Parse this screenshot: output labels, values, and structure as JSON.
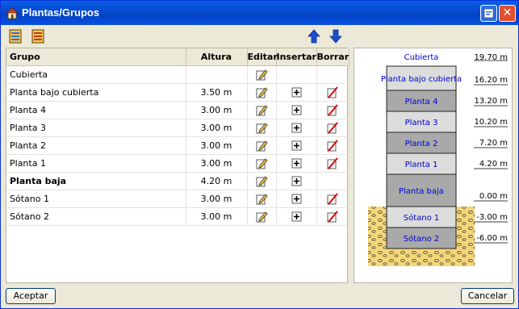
{
  "window": {
    "title": "Plantas/Grupos"
  },
  "icons": {
    "title": "building-icon",
    "help": "help-icon",
    "close": "close-icon",
    "toolbar": [
      "add-floor-icon",
      "edit-floor-icon"
    ],
    "up": "arrow-up-icon",
    "down": "arrow-down-icon",
    "edit": "pencil-icon",
    "insert": "insert-plus-icon",
    "delete": "delete-icon"
  },
  "table": {
    "headers": {
      "group": "Grupo",
      "height": "Altura",
      "edit": "Editar",
      "insert": "Insertar",
      "delete": "Borrar"
    },
    "rows": [
      {
        "name": "Cubierta",
        "height": "",
        "edit": true,
        "insert": false,
        "delete": false,
        "bold": false
      },
      {
        "name": "Planta bajo cubierta",
        "height": "3.50 m",
        "edit": true,
        "insert": true,
        "delete": true,
        "bold": false
      },
      {
        "name": "Planta 4",
        "height": "3.00 m",
        "edit": true,
        "insert": true,
        "delete": true,
        "bold": false
      },
      {
        "name": "Planta 3",
        "height": "3.00 m",
        "edit": true,
        "insert": true,
        "delete": true,
        "bold": false
      },
      {
        "name": "Planta 2",
        "height": "3.00 m",
        "edit": true,
        "insert": true,
        "delete": true,
        "bold": false
      },
      {
        "name": "Planta 1",
        "height": "3.00 m",
        "edit": true,
        "insert": true,
        "delete": true,
        "bold": false
      },
      {
        "name": "Planta baja",
        "height": "4.20 m",
        "edit": true,
        "insert": true,
        "delete": false,
        "bold": true
      },
      {
        "name": "Sótano 1",
        "height": "3.00 m",
        "edit": true,
        "insert": true,
        "delete": true,
        "bold": false
      },
      {
        "name": "Sótano 2",
        "height": "3.00 m",
        "edit": true,
        "insert": true,
        "delete": true,
        "bold": false
      }
    ]
  },
  "scheme": {
    "floors": [
      {
        "name": "Cubierta",
        "level": "19.70 m",
        "fill": "#ffffff"
      },
      {
        "name": "Planta bajo cubierta",
        "level": "16.20 m",
        "fill": "#dcdcdc"
      },
      {
        "name": "Planta 4",
        "level": "13.20 m",
        "fill": "#a9a9a9"
      },
      {
        "name": "Planta 3",
        "level": "10.20 m",
        "fill": "#dcdcdc"
      },
      {
        "name": "Planta 2",
        "level": "7.20 m",
        "fill": "#a9a9a9"
      },
      {
        "name": "Planta 1",
        "level": "4.20 m",
        "fill": "#dcdcdc"
      },
      {
        "name": "Planta baja",
        "level": "0.00 m",
        "fill": "#a9a9a9"
      },
      {
        "name": "Sótano 1",
        "level": "-3.00 m",
        "fill": "#dcdcdc"
      },
      {
        "name": "Sótano 2",
        "level": "-6.00 m",
        "fill": "#a9a9a9"
      }
    ],
    "text_color": "#0000cc",
    "soil_color": "#f5d77a"
  },
  "buttons": {
    "accept": "Aceptar",
    "cancel": "Cancelar"
  }
}
